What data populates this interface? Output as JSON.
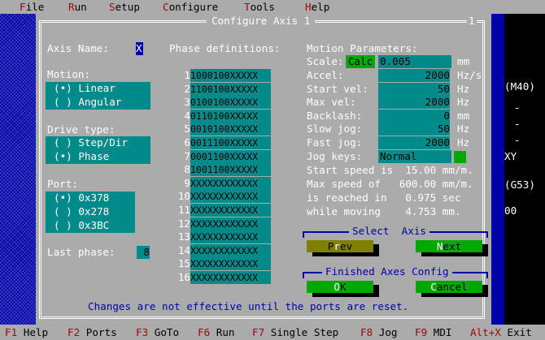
{
  "menu": [
    {
      "hot": "F",
      "rest": "ile"
    },
    {
      "hot": "R",
      "rest": "un"
    },
    {
      "hot": "S",
      "rest": "etup"
    },
    {
      "hot": "C",
      "rest": "onfigure"
    },
    {
      "hot": "T",
      "rest": "ools"
    },
    {
      "hot": "H",
      "rest": "elp"
    }
  ],
  "dialog": {
    "title": "Configure Axis 1",
    "corner_mark": "1",
    "axis_name_label": "Axis Name:",
    "axis_name_value": "X",
    "motion_label": "Motion:",
    "motion_options": [
      "(•) Linear",
      "( ) Angular"
    ],
    "drive_type_label": "Drive type:",
    "drive_options": [
      "( ) Step/Dir",
      "(•) Phase"
    ],
    "port_label": "Port:",
    "port_options": [
      "(•) 0x378",
      "( ) 0x278",
      "( ) 0x3BC"
    ],
    "last_phase_label": "Last phase:",
    "last_phase_value": "8",
    "phase_definitions_label": "Phase definitions:",
    "phases": [
      {
        "n": "1",
        "v": "1000100XXXXX"
      },
      {
        "n": "2",
        "v": "1100100XXXXX"
      },
      {
        "n": "3",
        "v": "0100100XXXXX"
      },
      {
        "n": "4",
        "v": "0110100XXXXX"
      },
      {
        "n": "5",
        "v": "0010100XXXXX"
      },
      {
        "n": "6",
        "v": "0011100XXXXX"
      },
      {
        "n": "7",
        "v": "0001100XXXXX"
      },
      {
        "n": "8",
        "v": "1001100XXXXX"
      },
      {
        "n": "9",
        "v": "XXXXXXXXXXXX"
      },
      {
        "n": "10",
        "v": "XXXXXXXXXXXX"
      },
      {
        "n": "11",
        "v": "XXXXXXXXXXXX"
      },
      {
        "n": "12",
        "v": "XXXXXXXXXXXX"
      },
      {
        "n": "13",
        "v": "XXXXXXXXXXXX"
      },
      {
        "n": "14",
        "v": "XXXXXXXXXXXX"
      },
      {
        "n": "15",
        "v": "XXXXXXXXXXXX"
      },
      {
        "n": "16",
        "v": "XXXXXXXXXXXX"
      }
    ],
    "motion_params_label": "Motion Parameters:",
    "scale_label": "Scale:",
    "calc_button": "Calc",
    "scale_value": "0.005",
    "scale_unit": "mm",
    "params": [
      {
        "label": "Accel:",
        "value": "2000",
        "unit": "Hz/s"
      },
      {
        "label": "Start vel:",
        "value": "50",
        "unit": "Hz"
      },
      {
        "label": "Max vel:",
        "value": "2000",
        "unit": "Hz"
      },
      {
        "label": "Backlash:",
        "value": "0",
        "unit": "mm"
      },
      {
        "label": "Slow jog:",
        "value": "50",
        "unit": "Hz"
      },
      {
        "label": "Fast jog:",
        "value": "2000",
        "unit": "Hz"
      }
    ],
    "jog_keys_label": "Jog keys:",
    "jog_keys_value": "Normal",
    "start_speed_line": "Start speed is  15.00 mm/m.",
    "max_speed_line": "Max speed of   600.00 mm/m.",
    "reached_line": "is reached in   0.975 sec",
    "while_moving_line": "while moving    4.753 mm.",
    "select_axis_label": "Select  Axis",
    "prev_button": {
      "pre": "P",
      "hot": "r",
      "post": "ev"
    },
    "next_button": {
      "pre": "",
      "hot": "N",
      "post": "ext"
    },
    "finished_label": "Finished Axes Config",
    "ok_button": {
      "pre": "",
      "hot": "O",
      "post": "K"
    },
    "cancel_button": {
      "pre": "",
      "hot": "C",
      "post": "ancel"
    },
    "note": "Changes are not effective until the ports are reset."
  },
  "right_panel": [
    "(M40)",
    "-",
    "-",
    "-",
    "XY",
    "(G53)",
    "00"
  ],
  "status_bar": [
    {
      "key": "F1",
      "label": " Help"
    },
    {
      "key": "F2",
      "label": " Ports"
    },
    {
      "key": "F3",
      "label": " GoTo"
    },
    {
      "key": "F6",
      "label": " Run"
    },
    {
      "key": "F7",
      "label": " Single Step"
    },
    {
      "key": "F8",
      "label": " Jog"
    },
    {
      "key": "F9",
      "label": " MDI"
    },
    {
      "key": "Alt+X",
      "label": " Exit"
    }
  ]
}
